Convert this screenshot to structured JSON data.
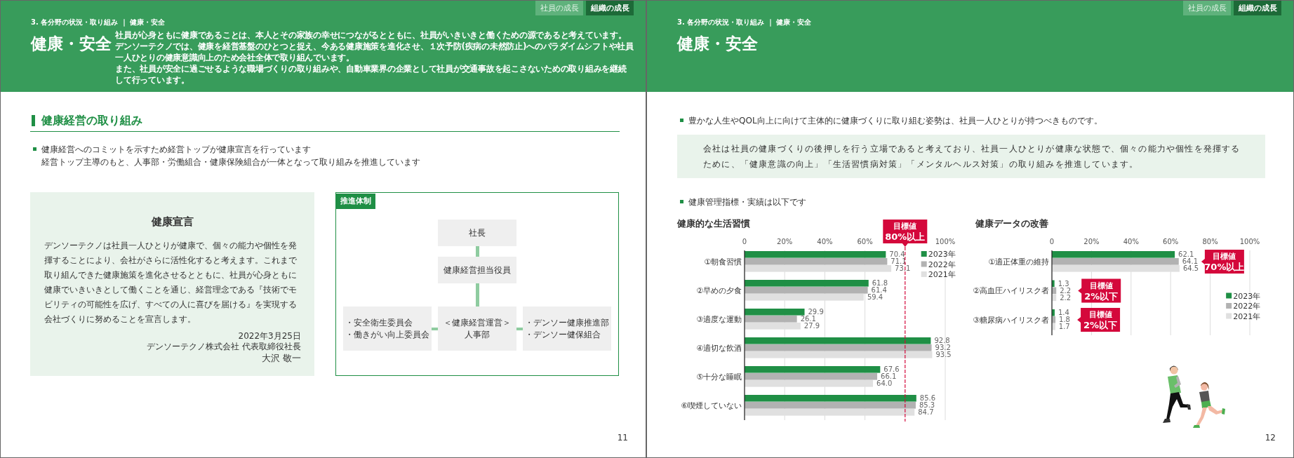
{
  "left_page": {
    "header": {
      "breadcrumb": "3. 各分野の状況・取り組み ｜ 健康・安全",
      "title": "健康・安全",
      "tabs": [
        {
          "label": "社員の成長",
          "selected": false
        },
        {
          "label": "組織の成長",
          "selected": true
        }
      ],
      "intro": [
        "社員が心身ともに健康であることは、本人とその家族の幸せにつながるとともに、社員がいきいきと働くための源であると考えています。",
        "デンソーテクノでは、健康を経営基盤のひとつと捉え、今ある健康施策を進化させ、１次予防(疾病の未然防止)へのパラダイムシフトや社員一人ひとりの健康意識向上のため会社全体で取り組んでいます。",
        "また、社員が安全に過ごせるような職場づくりの取り組みや、自動車業界の企業として社員が交通事故を起こさないための取り組みを継続して行っています。"
      ]
    },
    "section_heading": "健康経営の取り組み",
    "bullet": [
      "健康経営へのコミットを示すため経営トップが健康宣言を行っています",
      "経営トップ主導のもと、人事部・労働組合・健康保険組合が一体となって取り組みを推進しています"
    ],
    "declaration": {
      "title": "健康宣言",
      "text": "デンソーテクノは社員一人ひとりが健康で、個々の能力や個性を発揮することにより、会社がさらに活性化すると考えます。これまで取り組んできた健康施策を進化させるとともに、社員が心身ともに健康でいきいきとして働くことを通じ、経営理念である『技術でモビリティの可能性を広げ、すべての人に喜びを届ける』を実現する会社づくりに努めることを宣言します。",
      "date": "2022年3月25日",
      "company": "デンソーテクノ株式会社 代表取締役社長",
      "name": "大沢 敬一"
    },
    "org_chart": {
      "label": "推進体制",
      "top": "社長",
      "officer": "健康経営担当役員",
      "left": [
        "・安全衛生委員会",
        "・働きがい向上委員会"
      ],
      "center": [
        "＜健康経営運営＞",
        "人事部"
      ],
      "right": [
        "・デンソー健康推進部",
        "・デンソー健保組合"
      ]
    },
    "page_number": "11"
  },
  "right_page": {
    "header": {
      "breadcrumb": "3. 各分野の状況・取り組み ｜ 健康・安全",
      "title": "健康・安全",
      "tabs": [
        {
          "label": "社員の成長",
          "selected": false
        },
        {
          "label": "組織の成長",
          "selected": true
        }
      ]
    },
    "intro_bullet": "豊かな人生やQOL向上に向けて主体的に健康づくりに取り組む姿勢は、社員一人ひとりが持つべきものです。",
    "callout": "会社は社員の健康づくりの後押しを行う立場であると考えており、社員一人ひとりが健康な状態で、個々の能力や個性を発揮するために、「健康意識の向上」「生活習慣病対策」「メンタルヘルス対策」の取り組みを推進しています。",
    "metrics_bullet": "健康管理指標・実績は以下です",
    "charts": [
      {
        "chart_data": {
          "type": "bar",
          "orientation": "horizontal",
          "title": "健康的な生活習慣",
          "categories": [
            "①朝食習慣",
            "②早めの夕食",
            "③適度な運動",
            "④適切な飲酒",
            "⑤十分な睡眠",
            "⑥喫煙していない"
          ],
          "series": [
            {
              "name": "2023年",
              "color": "#1f8f45",
              "values": [
                70.4,
                61.8,
                29.9,
                92.8,
                67.6,
                85.6
              ],
              "value_labels": [
                "70.4",
                "61.8",
                "29.9",
                "92.8",
                "67.6",
                "85.6"
              ]
            },
            {
              "name": "2022年",
              "color": "#b2b2b2",
              "values": [
                71.1,
                61.4,
                26.1,
                93.2,
                66.1,
                85.3
              ],
              "value_labels": [
                "71.1",
                "61.4",
                "26.1",
                "93.2",
                "66.1",
                "85.3"
              ]
            },
            {
              "name": "2021年",
              "color": "#e0e0e0",
              "values": [
                73.1,
                59.4,
                27.9,
                93.5,
                64.0,
                84.7
              ],
              "value_labels": [
                "73.1",
                "59.4",
                "27.9",
                "93.5",
                "64.0",
                "84.7"
              ]
            }
          ],
          "xlim": [
            0,
            100
          ],
          "xticks": [
            {
              "value": 0,
              "label": "0"
            },
            {
              "value": 20,
              "label": "20%"
            },
            {
              "value": 40,
              "label": "40%"
            },
            {
              "value": 60,
              "label": "60%"
            },
            {
              "value": 100,
              "label": "100%"
            }
          ],
          "grid": true,
          "legend": true,
          "ref_lines": [
            {
              "axis": "x",
              "value": 80,
              "label": "目標値 80%以上"
            }
          ]
        }
      },
      {
        "chart_data": {
          "type": "bar",
          "orientation": "horizontal",
          "title": "健康データの改善",
          "categories": [
            "①適正体重の維持",
            "②高血圧ハイリスク者",
            "③糖尿病ハイリスク者"
          ],
          "series": [
            {
              "name": "2023年",
              "color": "#1f8f45",
              "values": [
                62.1,
                1.3,
                1.4
              ],
              "value_labels": [
                "62.1",
                "1.3",
                "1.4"
              ]
            },
            {
              "name": "2022年",
              "color": "#b2b2b2",
              "values": [
                64.1,
                2.2,
                1.8
              ],
              "value_labels": [
                "64.1",
                "2.2",
                "1.8"
              ]
            },
            {
              "name": "2021年",
              "color": "#e0e0e0",
              "values": [
                64.5,
                2.2,
                1.7
              ],
              "value_labels": [
                "64.5",
                "2.2",
                "1.7"
              ]
            }
          ],
          "xlim": [
            0,
            100
          ],
          "xticks": [
            {
              "value": 0,
              "label": "0"
            },
            {
              "value": 20,
              "label": "20%"
            },
            {
              "value": 40,
              "label": "40%"
            },
            {
              "value": 60,
              "label": "60%"
            },
            {
              "value": 80,
              "label": "80%"
            },
            {
              "value": 100,
              "label": "100%"
            }
          ],
          "grid": true,
          "legend": true,
          "annotations": [
            "目標値 70%以上",
            "目標値 2%以下",
            "目標値 2%以下"
          ]
        }
      }
    ],
    "page_number": "12"
  }
}
